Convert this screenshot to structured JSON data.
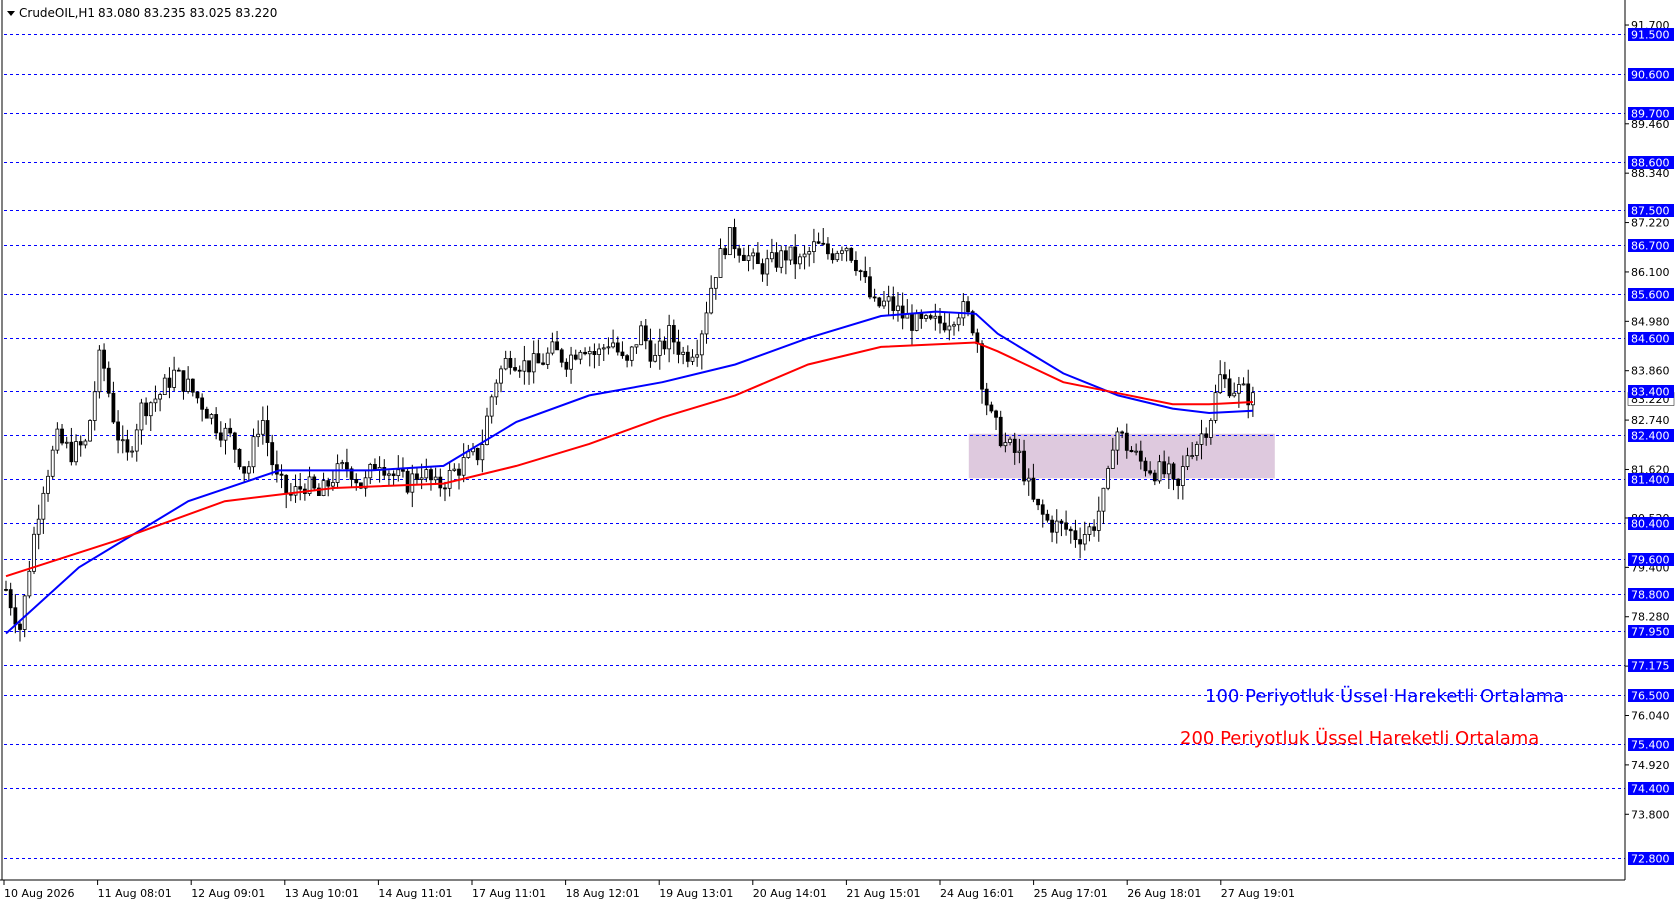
{
  "header": {
    "symbol": "CrudeOIL,H1",
    "ohlc": "83.080 83.235 83.025 83.220"
  },
  "colors": {
    "background": "#ffffff",
    "level_line": "#0000ff",
    "level_label_bg": "#0000ff",
    "ema100": "#0000ff",
    "ema200": "#ff0000",
    "candles": "#000000",
    "zone_fill": "#d8bfd8"
  },
  "legend": {
    "ema100_label": "100 Periyotluk Üssel Hareketli Ortalama",
    "ema200_label": "200  Periyotluk Üssel Hareketli Ortalama"
  },
  "chart_data": {
    "type": "candlestick",
    "title": "CrudeOIL,H1",
    "y_range": [
      72.4,
      91.95
    ],
    "price_ticks": [
      "91.700",
      "89.460",
      "88.340",
      "87.220",
      "86.100",
      "84.980",
      "83.860",
      "82.740",
      "81.620",
      "80.520",
      "79.400",
      "78.280",
      "77.160",
      "76.040",
      "74.920",
      "73.800"
    ],
    "horizontal_levels": [
      "91.500",
      "90.600",
      "89.700",
      "88.600",
      "87.500",
      "86.700",
      "85.600",
      "84.600",
      "83.400",
      "82.400",
      "81.400",
      "80.400",
      "79.600",
      "78.800",
      "77.950",
      "77.175",
      "76.500",
      "75.400",
      "74.400",
      "72.800"
    ],
    "current_price": "83.220",
    "x_labels": [
      "10 Aug 2026",
      "11 Aug 08:01",
      "12 Aug 09:01",
      "13 Aug 10:01",
      "14 Aug 11:01",
      "17 Aug 11:01",
      "18 Aug 12:01",
      "19 Aug 13:01",
      "20 Aug 14:01",
      "21 Aug 15:01",
      "24 Aug 16:01",
      "25 Aug 17:01",
      "26 Aug 18:01",
      "27 Aug 19:01"
    ],
    "candle_count": 268,
    "close_path": [
      [
        0,
        78.9
      ],
      [
        4,
        78.0
      ],
      [
        7,
        79.8
      ],
      [
        10,
        81.2
      ],
      [
        14,
        82.3
      ],
      [
        18,
        82.0
      ],
      [
        22,
        82.2
      ],
      [
        26,
        84.3
      ],
      [
        30,
        82.6
      ],
      [
        33,
        81.8
      ],
      [
        37,
        83.0
      ],
      [
        42,
        83.3
      ],
      [
        46,
        83.8
      ],
      [
        50,
        83.5
      ],
      [
        54,
        83.1
      ],
      [
        58,
        82.6
      ],
      [
        62,
        82.3
      ],
      [
        66,
        81.5
      ],
      [
        70,
        82.9
      ],
      [
        74,
        81.4
      ],
      [
        78,
        81.0
      ],
      [
        82,
        81.3
      ],
      [
        86,
        81.0
      ],
      [
        90,
        81.5
      ],
      [
        94,
        81.7
      ],
      [
        98,
        81.2
      ],
      [
        102,
        81.9
      ],
      [
        106,
        81.5
      ],
      [
        110,
        81.3
      ],
      [
        114,
        81.6
      ],
      [
        118,
        81.2
      ],
      [
        122,
        81.5
      ],
      [
        126,
        81.8
      ],
      [
        130,
        82.0
      ],
      [
        134,
        83.6
      ],
      [
        138,
        84.2
      ],
      [
        142,
        84.0
      ],
      [
        146,
        84.0
      ],
      [
        150,
        84.3
      ],
      [
        154,
        84.1
      ],
      [
        158,
        84.5
      ],
      [
        162,
        84.2
      ],
      [
        166,
        84.6
      ],
      [
        170,
        83.9
      ],
      [
        174,
        84.8
      ],
      [
        178,
        84.1
      ],
      [
        182,
        84.7
      ],
      [
        186,
        84.2
      ],
      [
        190,
        84.5
      ],
      [
        194,
        86.0
      ],
      [
        198,
        86.9
      ],
      [
        202,
        86.6
      ],
      [
        206,
        86.2
      ],
      [
        210,
        86.3
      ],
      [
        214,
        86.5
      ],
      [
        218,
        86.3
      ],
      [
        222,
        86.7
      ],
      [
        226,
        86.5
      ],
      [
        230,
        86.8
      ],
      [
        234,
        86.2
      ],
      [
        238,
        85.3
      ],
      [
        242,
        85.4
      ],
      [
        246,
        85.1
      ],
      [
        250,
        84.9
      ],
      [
        254,
        84.9
      ],
      [
        258,
        85.0
      ],
      [
        262,
        85.3
      ],
      [
        266,
        84.8
      ],
      [
        268,
        83.5
      ],
      [
        270,
        82.8
      ],
      [
        274,
        82.2
      ],
      [
        278,
        81.9
      ],
      [
        282,
        80.8
      ],
      [
        286,
        80.4
      ],
      [
        290,
        80.3
      ],
      [
        294,
        80.1
      ],
      [
        298,
        80.3
      ],
      [
        302,
        81.2
      ],
      [
        304,
        82.6
      ],
      [
        307,
        82.2
      ],
      [
        311,
        81.8
      ],
      [
        315,
        81.6
      ],
      [
        319,
        81.5
      ],
      [
        321,
        81.0
      ],
      [
        324,
        82.0
      ],
      [
        327,
        82.3
      ],
      [
        330,
        82.7
      ],
      [
        333,
        83.7
      ],
      [
        336,
        83.5
      ],
      [
        339,
        83.4
      ],
      [
        342,
        83.2
      ]
    ],
    "series": [
      {
        "name": "100 Periyotluk Üssel Hareketli Ortalama",
        "color": "#0000ff",
        "points": [
          [
            0,
            77.9
          ],
          [
            20,
            79.4
          ],
          [
            50,
            80.9
          ],
          [
            75,
            81.6
          ],
          [
            100,
            81.6
          ],
          [
            120,
            81.7
          ],
          [
            140,
            82.7
          ],
          [
            160,
            83.3
          ],
          [
            180,
            83.6
          ],
          [
            200,
            84.0
          ],
          [
            220,
            84.6
          ],
          [
            240,
            85.1
          ],
          [
            255,
            85.2
          ],
          [
            266,
            85.15
          ],
          [
            272,
            84.7
          ],
          [
            290,
            83.8
          ],
          [
            305,
            83.3
          ],
          [
            320,
            83.0
          ],
          [
            330,
            82.9
          ],
          [
            342,
            82.95
          ]
        ]
      },
      {
        "name": "200  Periyotluk Üssel Hareketli Ortalama",
        "color": "#ff0000",
        "points": [
          [
            0,
            79.2
          ],
          [
            30,
            80.0
          ],
          [
            60,
            80.9
          ],
          [
            90,
            81.2
          ],
          [
            120,
            81.3
          ],
          [
            140,
            81.7
          ],
          [
            160,
            82.2
          ],
          [
            180,
            82.8
          ],
          [
            200,
            83.3
          ],
          [
            220,
            84.0
          ],
          [
            240,
            84.4
          ],
          [
            266,
            84.5
          ],
          [
            272,
            84.3
          ],
          [
            290,
            83.6
          ],
          [
            305,
            83.35
          ],
          [
            320,
            83.1
          ],
          [
            330,
            83.1
          ],
          [
            342,
            83.15
          ]
        ]
      }
    ],
    "zone": {
      "x_from": 268,
      "x_to": 353,
      "y_from": 81.42,
      "y_to": 82.43
    }
  }
}
